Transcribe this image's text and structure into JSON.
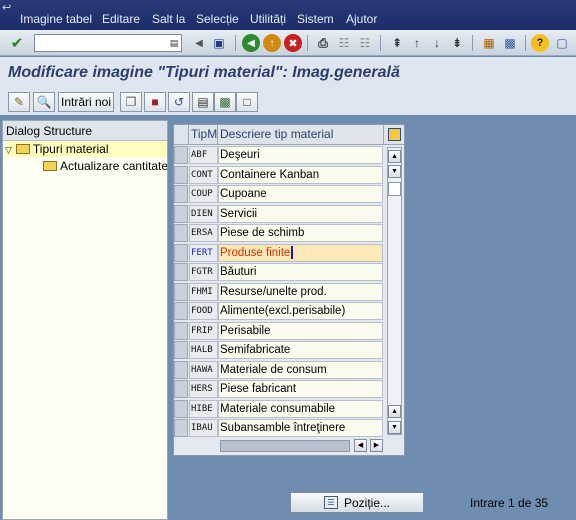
{
  "menubar": {
    "items": [
      "Imagine tabel",
      "Editare",
      "Salt la",
      "Selecție",
      "Utilități",
      "Sistem",
      "Ajutor"
    ]
  },
  "toolbar": {
    "command_field_value": ""
  },
  "title": "Modificare imagine \"Tipuri material\": Imag.generală",
  "app_toolbar": {
    "new_entries_label": "Intrări noi"
  },
  "dialog_structure": {
    "header": "Dialog Structure",
    "items": [
      {
        "label": "Tipuri material",
        "level": 0,
        "selected": true
      },
      {
        "label": "Actualizare cantitate/v",
        "level": 1,
        "selected": false
      }
    ]
  },
  "table": {
    "columns": [
      "TipM",
      "Descriere tip material"
    ],
    "rows": [
      {
        "code": "ABF",
        "desc": "Deşeuri"
      },
      {
        "code": "CONT",
        "desc": "Containere Kanban"
      },
      {
        "code": "COUP",
        "desc": "Cupoane"
      },
      {
        "code": "DIEN",
        "desc": "Servicii"
      },
      {
        "code": "ERSA",
        "desc": "Piese de schimb"
      },
      {
        "code": "FERT",
        "desc": "Produse finite"
      },
      {
        "code": "FGTR",
        "desc": "Băuturi"
      },
      {
        "code": "FHMI",
        "desc": "Resurse/unelte prod."
      },
      {
        "code": "FOOD",
        "desc": "Alimente(excl.perisabile)"
      },
      {
        "code": "FRIP",
        "desc": "Perisabile"
      },
      {
        "code": "HALB",
        "desc": "Semifabricate"
      },
      {
        "code": "HAWA",
        "desc": "Materiale de consum"
      },
      {
        "code": "HERS",
        "desc": "Piese fabricant"
      },
      {
        "code": "HIBE",
        "desc": "Materiale consumabile"
      },
      {
        "code": "IBAU",
        "desc": "Subansamble întreţinere"
      }
    ],
    "highlighted_row": 5
  },
  "footer": {
    "position_button_label": "Poziție...",
    "entry_info": "Intrare 1 de 35"
  },
  "colors": {
    "background": "#6f8db0",
    "highlight_row": "#fde9b8",
    "highlight_text": "#d23000"
  }
}
